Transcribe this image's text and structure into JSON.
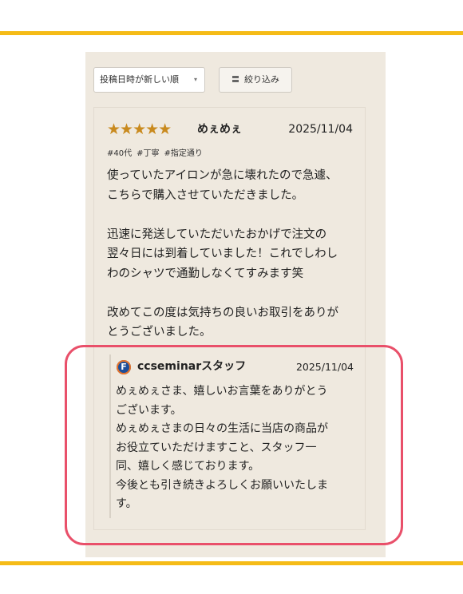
{
  "sort": {
    "label": "投稿日時が新しい順",
    "caret": "▾"
  },
  "filter": {
    "label": "絞り込み",
    "icon": "filter-icon"
  },
  "review": {
    "stars": "★★★★★",
    "rating": 5,
    "author": "めぇめぇ",
    "date": "2025/11/04",
    "tags": [
      "#40代",
      "#丁寧",
      "#指定通り"
    ],
    "text": "使っていたアイロンが急に壊れたので急遽、\nこちらで購入させていただきました。\n\n迅速に発送していただいたおかげで注文の\n翌々日には到着していました！これでしわし\nわのシャツで通勤しなくてすみます笑\n\n改めてこの度は気持ちの良いお取引をありが\nとうございました。"
  },
  "reply": {
    "logo_letter": "F",
    "name": "ccseminarスタッフ",
    "date": "2025/11/04",
    "text": "めぇめぇさま、嬉しいお言葉をありがとう\nございます。\nめぇめぇさまの日々の生活に当店の商品が\nお役立ていただけますこと、スタッフ一\n同、嬉しく感じております。\n今後とも引き続きよろしくお願いいたしま\nす。"
  },
  "colors": {
    "accent_line": "#f5bb17",
    "star": "#c98a1e",
    "highlight": "#e9506a",
    "panel": "#efe9df"
  }
}
